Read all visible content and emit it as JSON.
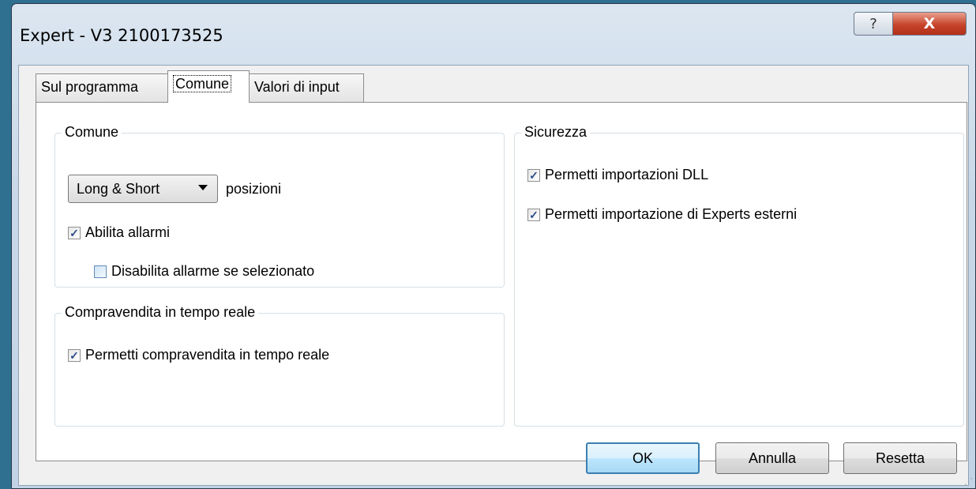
{
  "window": {
    "title": "Expert - V3 2100173525",
    "help_label": "?",
    "close_label": "X"
  },
  "tabs": [
    {
      "label": "Sul programma"
    },
    {
      "label": "Comune"
    },
    {
      "label": "Valori di input"
    }
  ],
  "comune_group": {
    "title": "Comune",
    "positions_select": {
      "value": "Long & Short"
    },
    "positions_label": "posizioni",
    "enable_alerts": {
      "label": "Abilita allarmi",
      "checked": true
    },
    "disable_alert": {
      "label": "Disabilita allarme se selezionato",
      "checked": false
    }
  },
  "realtime_group": {
    "title": "Compravendita in tempo reale",
    "allow_live": {
      "label": "Permetti compravendita in tempo reale",
      "checked": true
    }
  },
  "security_group": {
    "title": "Sicurezza",
    "allow_dll": {
      "label": "Permetti importazioni DLL",
      "checked": true
    },
    "allow_experts": {
      "label": "Permetti importazione di Experts esterni",
      "checked": true
    }
  },
  "buttons": {
    "ok": "OK",
    "cancel": "Annulla",
    "reset": "Resetta"
  }
}
